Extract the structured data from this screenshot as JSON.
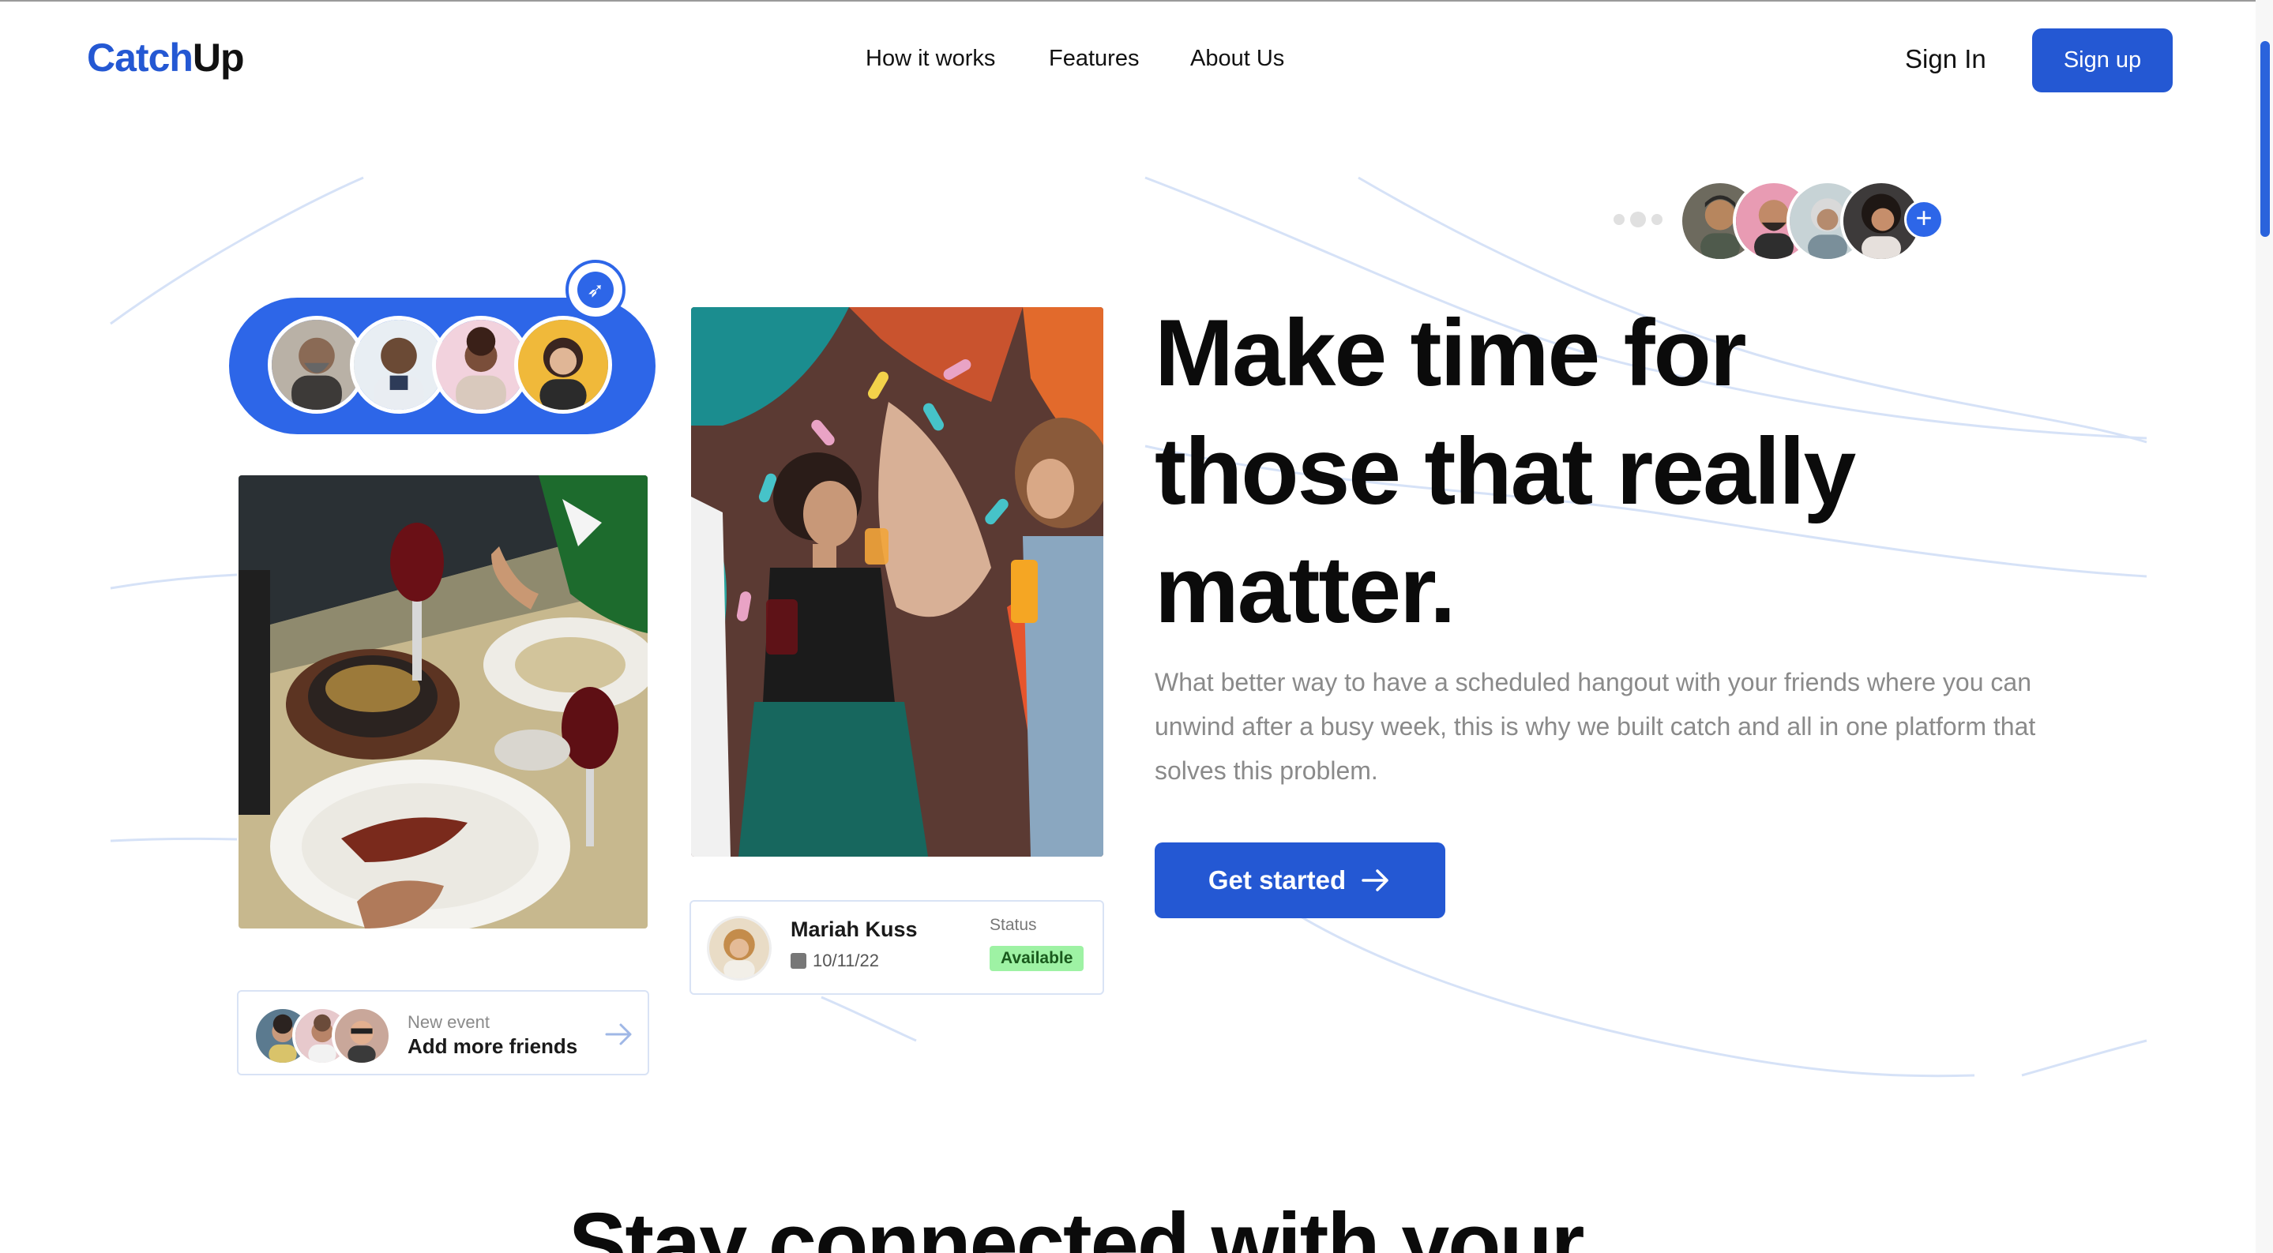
{
  "header": {
    "logo_part1": "Catch",
    "logo_part2": "Up",
    "nav": [
      "How it works",
      "Features",
      "About Us"
    ],
    "sign_in": "Sign In",
    "sign_up": "Sign up"
  },
  "hero": {
    "headline_lines": [
      "Make time for",
      "those that really",
      "matter."
    ],
    "subtext": "What better way to have a scheduled hangout with your friends where you can unwind after a busy week, this is why we built catch and all in one platform that solves this problem.",
    "cta": "Get started",
    "cta_icon": "arrow-right-icon"
  },
  "friends_card": {
    "label_small": "New event",
    "label_main": "Add more friends",
    "icon": "arrow-right-icon"
  },
  "status_card": {
    "name": "Mariah Kuss",
    "date": "10/11/22",
    "status_label": "Status",
    "status_value": "Available"
  },
  "colors": {
    "brand": "#2458d3",
    "pill": "#2d66e8",
    "available_badge": "#9ef2a4"
  },
  "next_section": {
    "title": "Stay connected with your"
  }
}
